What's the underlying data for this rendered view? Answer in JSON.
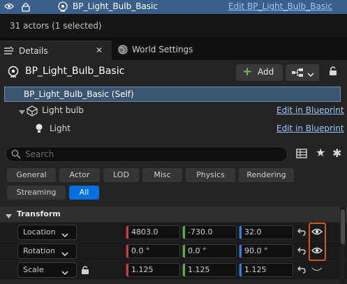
{
  "outliner": {
    "selected_actor": "BP_Light_Bulb_Basic",
    "edit_link": "Edit BP_Light_Bulb_Basic",
    "actor_count": "31 actors (1 selected)"
  },
  "tabs": [
    {
      "label": "Details",
      "close": "✕"
    },
    {
      "label": "World Settings"
    }
  ],
  "details": {
    "title": "BP_Light_Bulb_Basic",
    "add_label": "Add",
    "add_symbol": "+"
  },
  "components": [
    {
      "label": "BP_Light_Bulb_Basic (Self)"
    },
    {
      "label": "Light bulb",
      "edit": "Edit in Blueprint"
    },
    {
      "label": "Light",
      "edit": "Edit in Blueprint"
    }
  ],
  "search": {
    "placeholder": "Search"
  },
  "toolbar_icons": {
    "star": "★",
    "gear": "✱"
  },
  "filters": [
    {
      "label": "General",
      "active": false
    },
    {
      "label": "Actor",
      "active": false
    },
    {
      "label": "LOD",
      "active": false
    },
    {
      "label": "Misc",
      "active": false
    },
    {
      "label": "Physics",
      "active": false
    },
    {
      "label": "Rendering",
      "active": false
    },
    {
      "label": "Streaming",
      "active": false
    },
    {
      "label": "All",
      "active": true
    }
  ],
  "transform": {
    "section_label": "Transform",
    "rows": [
      {
        "label": "Location",
        "x": "4803.0",
        "y": "-730.0",
        "z": "32.0"
      },
      {
        "label": "Rotation",
        "x": "0.0 °",
        "y": "0.0 °",
        "z": "90.0 °"
      },
      {
        "label": "Scale",
        "x": "1.125",
        "y": "1.125",
        "z": "1.125"
      }
    ]
  },
  "colors": {
    "accent": "#0070e0",
    "selection": "#3a5f8a",
    "link": "#9bc5ff",
    "axis_x": "#d03a3a",
    "axis_y": "#5fae2e",
    "axis_z": "#2f7fe0",
    "highlight": "#d4561e"
  }
}
